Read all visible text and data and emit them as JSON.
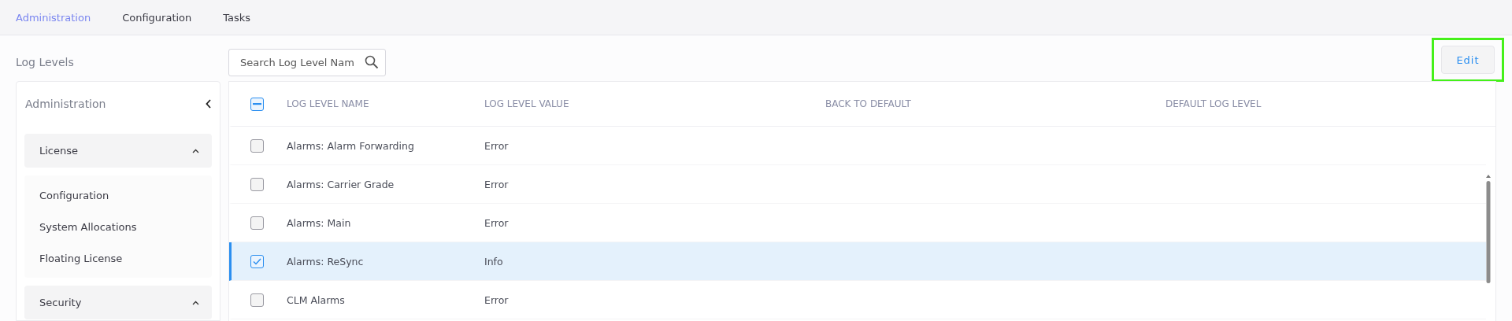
{
  "tabs": [
    {
      "label": "Administration",
      "selected": true
    },
    {
      "label": "Configuration",
      "selected": false
    },
    {
      "label": "Tasks",
      "selected": false
    }
  ],
  "page_title": "Log Levels",
  "search": {
    "placeholder": "Search Log Level Nam"
  },
  "edit_button": {
    "label": "Edit",
    "highlighted": true
  },
  "sidebar": {
    "title": "Administration",
    "sections": [
      {
        "label": "License",
        "expanded": true,
        "items": [
          "Configuration",
          "System Allocations",
          "Floating License"
        ]
      },
      {
        "label": "Security",
        "expanded": true
      }
    ]
  },
  "table": {
    "header_partially_checked": true,
    "columns": [
      "LOG LEVEL NAME",
      "LOG LEVEL VALUE",
      "BACK TO DEFAULT",
      "DEFAULT LOG LEVEL"
    ],
    "rows": [
      {
        "name": "Alarms: Alarm Forwarding",
        "value": "Error",
        "checked": false,
        "selected": false
      },
      {
        "name": "Alarms: Carrier Grade",
        "value": "Error",
        "checked": false,
        "selected": false
      },
      {
        "name": "Alarms: Main",
        "value": "Error",
        "checked": false,
        "selected": false
      },
      {
        "name": "Alarms: ReSync",
        "value": "Info",
        "checked": true,
        "selected": true
      },
      {
        "name": "CLM Alarms",
        "value": "Error",
        "checked": false,
        "selected": false
      }
    ]
  }
}
